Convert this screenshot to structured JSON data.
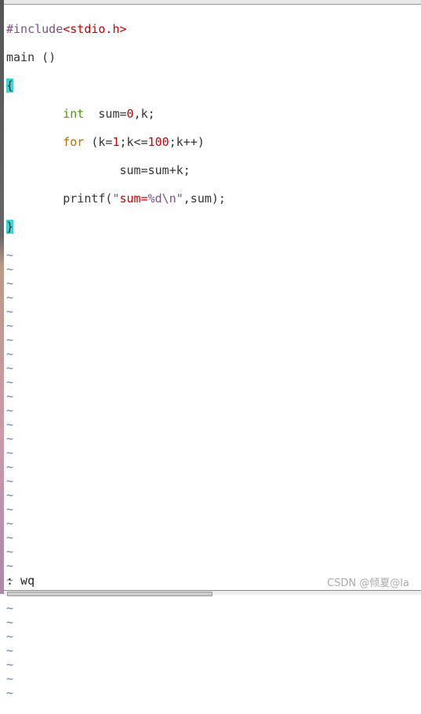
{
  "code": {
    "include_directive": "#include",
    "include_header": "<stdio.h>",
    "main_decl": "main ()",
    "open_brace": "{",
    "indent": "        ",
    "indent2": "                ",
    "int_kw": "int",
    "decl_rest_1": "  sum=",
    "decl_zero": "0",
    "decl_rest_2": ",k;",
    "for_kw": "for",
    "for_1": " (k=",
    "for_one": "1",
    "for_2": ";k<=",
    "for_hundred": "100",
    "for_3": ";k++)",
    "body_stmt": "sum=sum+k;",
    "printf_1": "printf(",
    "printf_quote": "\"",
    "printf_str": "sum=",
    "printf_fmt": "%d\\n",
    "printf_2": ",sum);",
    "close_brace": "}",
    "tilde": "~"
  },
  "command_line": ": wq",
  "watermark": "CSDN @倾夏@la",
  "colors": {
    "preprocessor": "#7a4f8a",
    "string": "#cc0000",
    "type": "#4c9a00",
    "keyword": "#b86a00",
    "brace_highlight": "#3ad6d6",
    "tilde": "#5a7fd0"
  }
}
